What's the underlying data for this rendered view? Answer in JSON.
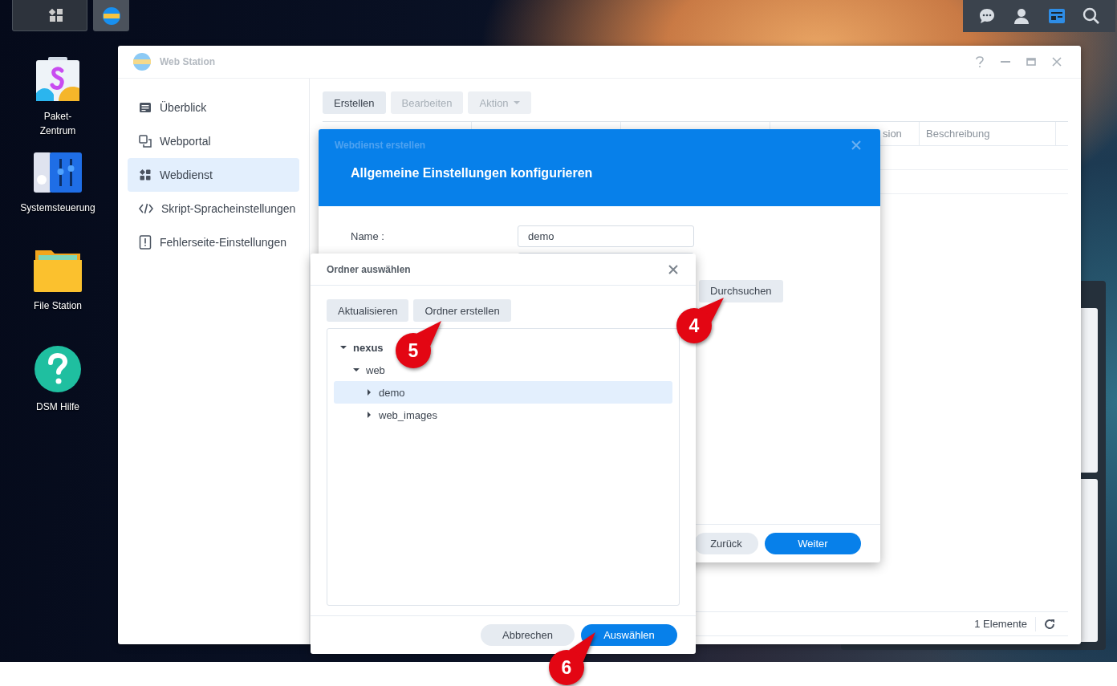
{
  "desktop_icons": [
    {
      "kind": "package",
      "label": "Paket-Zentrum"
    },
    {
      "kind": "control",
      "label": "Systemsteuerung"
    },
    {
      "kind": "folder",
      "label": "File Station"
    },
    {
      "kind": "help",
      "label": "DSM Hilfe"
    }
  ],
  "window": {
    "title": "Web Station"
  },
  "sidebar": {
    "items": [
      {
        "kind": "overview",
        "label": "Überblick",
        "selected": false
      },
      {
        "kind": "portal",
        "label": "Webportal",
        "selected": false
      },
      {
        "kind": "service",
        "label": "Webdienst",
        "selected": true
      },
      {
        "kind": "script",
        "label": "Skript-Spracheinstellungen",
        "selected": false
      },
      {
        "kind": "error",
        "label": "Fehlerseite-Einstellungen",
        "selected": false
      }
    ]
  },
  "toolbar": [
    {
      "label": "Erstellen",
      "disabled": false
    },
    {
      "label": "Bearbeiten",
      "disabled": true
    },
    {
      "label": "Aktion",
      "disabled": true,
      "dropdown": true
    }
  ],
  "table": {
    "columns": [
      "sion",
      "Beschreibung"
    ],
    "footer": "1 Elemente"
  },
  "create_dialog": {
    "subtitle": "Webdienst erstellen",
    "title": "Allgemeine Einstellungen konfigurieren",
    "name_label": "Name :",
    "name_value": "demo",
    "browse_button": "Durchsuchen",
    "buttons": [
      {
        "label": "Zurück",
        "kind": "secondary"
      },
      {
        "label": "Weiter",
        "kind": "primary"
      }
    ]
  },
  "folder_dialog": {
    "title": "Ordner auswählen",
    "toolbar": [
      "Aktualisieren",
      "Ordner erstellen"
    ],
    "tree": [
      {
        "label": "nexus",
        "expanded": true,
        "selected": false,
        "children": [
          {
            "label": "web",
            "expanded": true,
            "selected": false,
            "children": [
              {
                "label": "demo",
                "expanded": false,
                "selected": true
              },
              {
                "label": "web_images",
                "expanded": false,
                "selected": false
              }
            ]
          }
        ]
      }
    ],
    "buttons": [
      {
        "label": "Abbrechen",
        "kind": "secondary"
      },
      {
        "label": "Auswählen",
        "kind": "primary"
      }
    ]
  },
  "callouts": [
    "4",
    "5",
    "6"
  ]
}
